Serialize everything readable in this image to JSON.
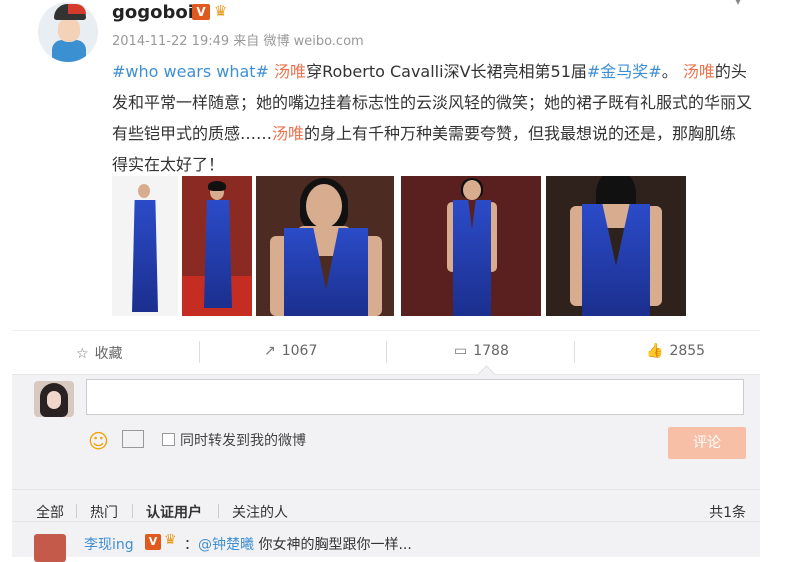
{
  "post": {
    "username": "gogoboi",
    "verified_badge": "V",
    "vip_icon": "vip-crown-icon",
    "timestamp": "2014-11-22 19:49",
    "source_prefix": "来自",
    "source": "微博 weibo.com",
    "content": {
      "tag1": "#who wears what#",
      "name1": "汤唯",
      "text1": "穿Roberto Cavalli深V长裙亮相第51届",
      "tag2": "#金马奖#",
      "text2": "。",
      "name2": "汤唯",
      "text3": "的头发和平常一样随意；她的嘴边挂着标志性的云淡风轻的微笑；她的裙子既有礼服式的华丽又有些铠甲式的质感……",
      "name3": "汤唯",
      "text4": "的身上有千种万种美需要夸赞，但我最想说的还是，那胸肌练得实在太好了！"
    },
    "photo_count": 5
  },
  "actions": {
    "favorite_label": "收藏",
    "favorite_icon": "star-outline-icon",
    "repost_count": "1067",
    "repost_icon": "repost-icon",
    "comment_count": "1788",
    "comment_icon": "comment-icon",
    "like_count": "2855",
    "like_icon": "thumbs-up-icon"
  },
  "composer": {
    "placeholder": "",
    "emoji_icon": "emoji-icon",
    "image_icon": "image-icon",
    "forward_label": "同时转发到我的微博",
    "submit_label": "评论"
  },
  "filters": {
    "all": "全部",
    "hot": "热门",
    "verified": "认证用户",
    "following": "关注的人",
    "total": "共1条"
  },
  "comments": [
    {
      "author": "李现ing",
      "badge": "V",
      "mention": "@钟楚曦",
      "text": " 你女神的胸型跟你一样..."
    }
  ]
}
